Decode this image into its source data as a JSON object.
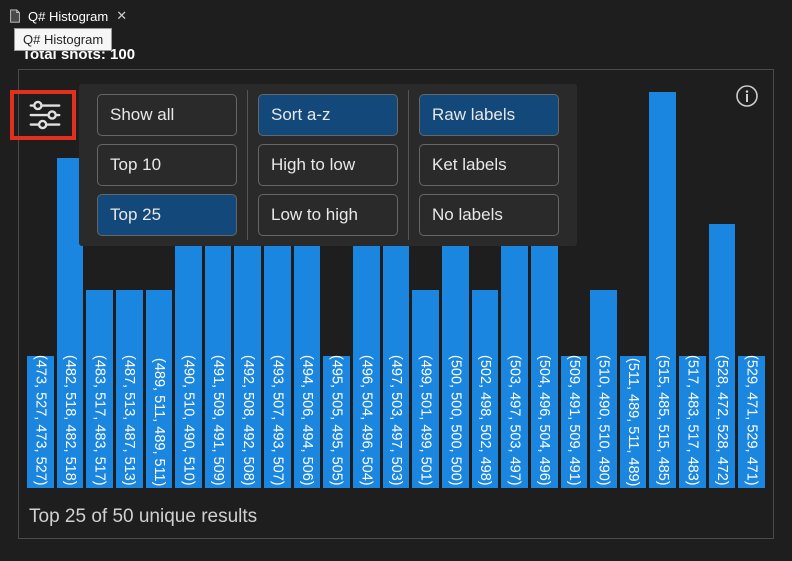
{
  "tab": {
    "title": "Q# Histogram"
  },
  "tooltip": "Q# Histogram",
  "stats_label": "Total shots: 100",
  "controls": {
    "col1": [
      {
        "label": "Show all",
        "active": false
      },
      {
        "label": "Top 10",
        "active": false
      },
      {
        "label": "Top 25",
        "active": true
      }
    ],
    "col2": [
      {
        "label": "Sort a-z",
        "active": true
      },
      {
        "label": "High to low",
        "active": false
      },
      {
        "label": "Low to high",
        "active": false
      }
    ],
    "col3": [
      {
        "label": "Raw labels",
        "active": true
      },
      {
        "label": "Ket labels",
        "active": false
      },
      {
        "label": "No labels",
        "active": false
      }
    ]
  },
  "footer": "Top 25 of 50 unique results",
  "chart_data": {
    "type": "bar",
    "title": "Q# Histogram",
    "xlabel": "",
    "ylabel": "",
    "ylim": [
      0,
      6
    ],
    "categories": [
      "(473, 527, 473, 527)",
      "(482, 518, 482, 518)",
      "(483, 517, 483, 517)",
      "(487, 513, 487, 513)",
      "(489, 511, 489, 511)",
      "(490, 510, 490, 510)",
      "(491, 509, 491, 509)",
      "(492, 508, 492, 508)",
      "(493, 507, 493, 507)",
      "(494, 506, 494, 506)",
      "(495, 505, 495, 505)",
      "(496, 504, 496, 504)",
      "(497, 503, 497, 503)",
      "(499, 501, 499, 501)",
      "(500, 500, 500, 500)",
      "(502, 498, 502, 498)",
      "(503, 497, 503, 497)",
      "(504, 496, 504, 496)",
      "(509, 491, 509, 491)",
      "(510, 490, 510, 490)",
      "(511, 489, 511, 489)",
      "(515, 485, 515, 485)",
      "(517, 483, 517, 483)",
      "(528, 472, 528, 472)",
      "(529, 471, 529, 471)"
    ],
    "values": [
      2,
      5,
      3,
      3,
      3,
      5,
      5,
      4,
      4,
      4,
      2,
      5,
      5,
      3,
      5,
      3,
      5,
      5,
      2,
      3,
      2,
      6,
      2,
      4,
      2
    ]
  }
}
